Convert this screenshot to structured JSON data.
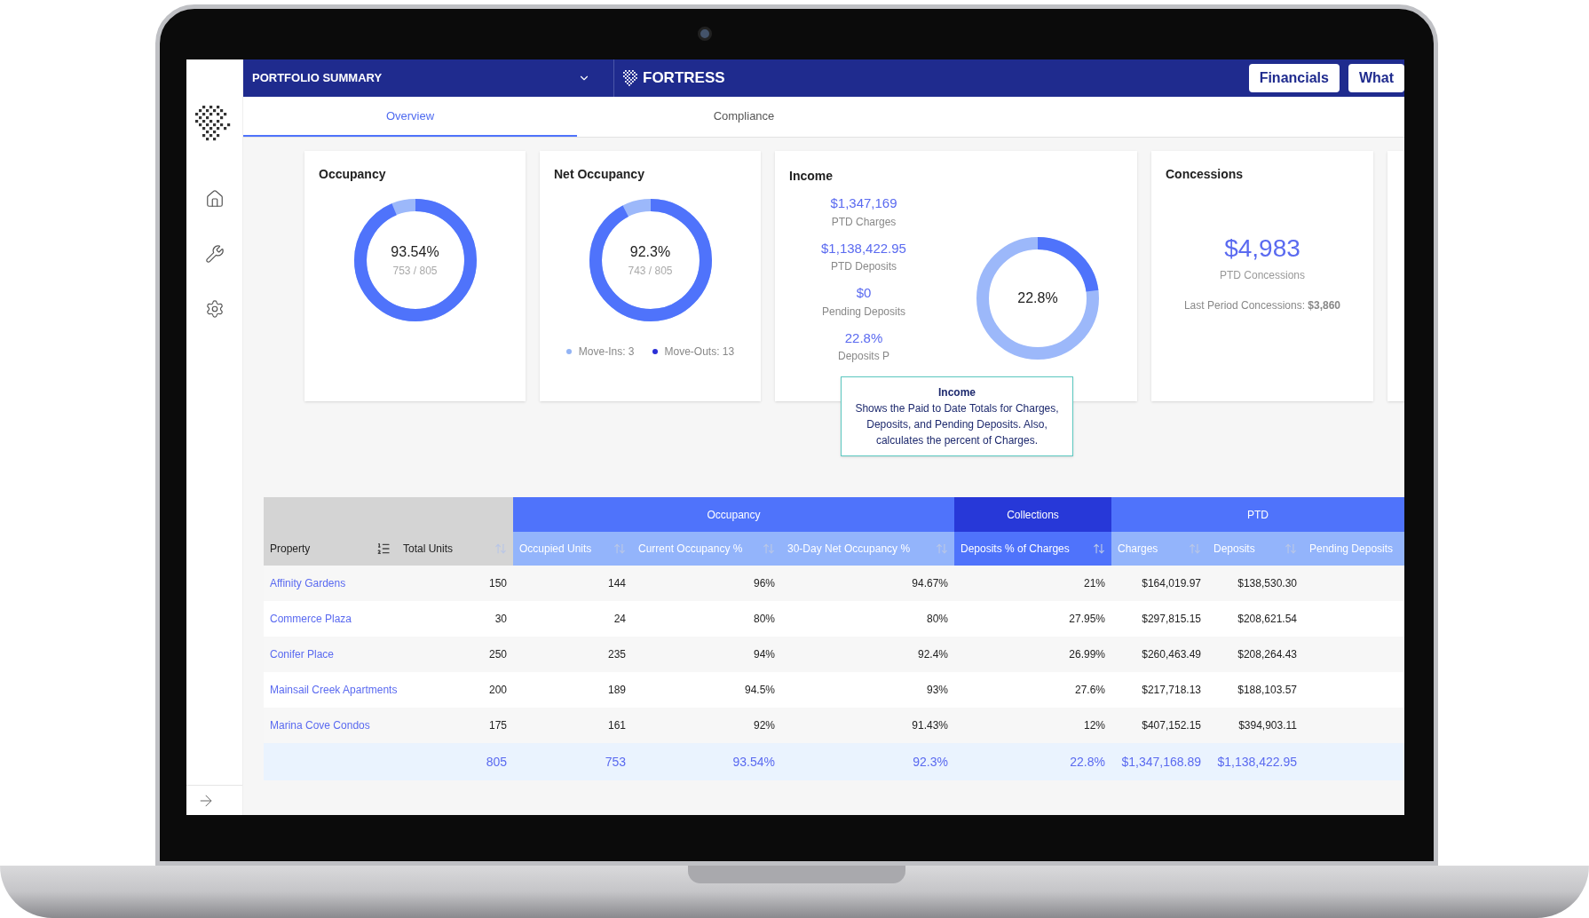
{
  "header": {
    "portfolio": "PORTFOLIO SUMMARY",
    "brand": "FORTRESS",
    "buttons": [
      "Financials",
      "What"
    ]
  },
  "tabs": [
    {
      "label": "Overview",
      "selected": true
    },
    {
      "label": "Compliance",
      "selected": false
    }
  ],
  "cards": [
    {
      "kind": "donut",
      "title": "Occupancy",
      "value": "93.54%",
      "sub": "753 / 805",
      "level": 0.9354
    },
    {
      "kind": "donut",
      "title": "Net Occupancy",
      "value": "92.3%",
      "sub": "743 / 805",
      "level": 0.923,
      "legend": [
        {
          "label": "Move-Ins: 3",
          "color": "#93b4f5"
        },
        {
          "label": "Move-Outs: 13",
          "color": "#2b2fd6"
        }
      ]
    },
    {
      "kind": "income",
      "title": "Income",
      "stats": [
        {
          "value": "$1,347,169",
          "label": "PTD Charges"
        },
        {
          "value": "$1,138,422.95",
          "label": "PTD Deposits"
        },
        {
          "value": "$0",
          "label": "Pending Deposits"
        },
        {
          "value": "22.8%",
          "label": "Deposits P"
        }
      ],
      "value": "22.8%",
      "level": 0.228,
      "tooltip": {
        "title": "Income",
        "text": "Shows the Paid to Date Totals for Charges, Deposits, and Pending Deposits. Also, calculates the percent of Charges."
      }
    },
    {
      "kind": "big",
      "title": "Concessions",
      "value": "$4,983",
      "sub": "PTD Concessions",
      "note": "Last Period Concessions: **$3,860**"
    },
    {
      "kind": "partial"
    }
  ],
  "table": {
    "groups": [
      {
        "kind": "plain",
        "columns": [
          {
            "label": "Property",
            "kind": "list"
          },
          {
            "label": "Total Units",
            "kind": "arrows"
          }
        ]
      },
      {
        "kind": "light",
        "label": "Occupancy",
        "columns": [
          {
            "label": "Occupied Units",
            "kind": "arrows"
          },
          {
            "label": "Current Occupancy %",
            "kind": "arrows"
          },
          {
            "label": "30-Day Net Occupancy %",
            "kind": "arrows"
          }
        ]
      },
      {
        "kind": "dark",
        "label": "Collections",
        "columns": [
          {
            "label": "Deposits % of Charges",
            "kind": "arrows"
          }
        ]
      },
      {
        "kind": "light",
        "label": "PTD",
        "columns": [
          {
            "label": "Charges",
            "kind": "arrows"
          },
          {
            "label": "Deposits",
            "kind": "arrows"
          },
          {
            "label": "Pending Deposits",
            "kind": "plain"
          }
        ]
      }
    ],
    "rows": [
      [
        "Affinity Gardens",
        "150",
        "144",
        "96%",
        "94.67%",
        "21%",
        "$164,019.97",
        "$138,530.30"
      ],
      [
        "Commerce Plaza",
        "30",
        "24",
        "80%",
        "80%",
        "27.95%",
        "$297,815.15",
        "$208,621.54"
      ],
      [
        "Conifer Place",
        "250",
        "235",
        "94%",
        "92.4%",
        "26.99%",
        "$260,463.49",
        "$208,264.43"
      ],
      [
        "Mainsail Creek Apartments",
        "200",
        "189",
        "94.5%",
        "93%",
        "27.6%",
        "$217,718.13",
        "$188,103.57"
      ],
      [
        "Marina Cove Condos",
        "175",
        "161",
        "92%",
        "91.43%",
        "12%",
        "$407,152.15",
        "$394,903.11"
      ]
    ],
    "totals": [
      "805",
      "753",
      "93.54%",
      "92.3%",
      "22.8%",
      "$1,347,168.89",
      "$1,138,422.95"
    ]
  }
}
